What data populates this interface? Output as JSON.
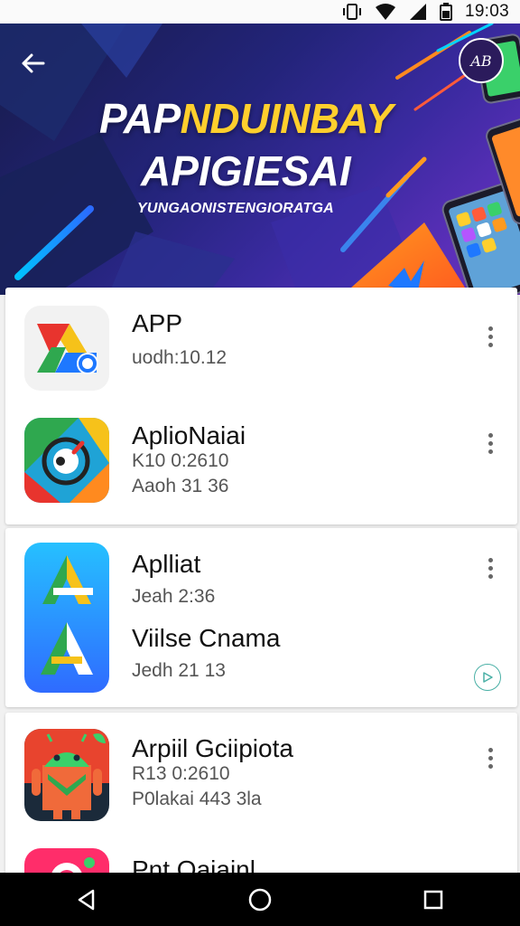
{
  "status_bar": {
    "time": "19:03",
    "icons": [
      "vibrate-icon",
      "wifi-icon",
      "signal-icon",
      "battery-icon"
    ]
  },
  "hero": {
    "title_line1_a": "PAP",
    "title_line1_b": "NDUINBAY",
    "title_line2": "APIGIESAI",
    "subtitle": "YUNGAONISTENGIORATGA",
    "badge_text": "AB",
    "back_icon": "arrow-back-icon"
  },
  "apps": [
    {
      "name": "APP",
      "meta": [
        "uodh:10.12"
      ],
      "icon": "google-drive-style-icon"
    },
    {
      "name": "AplioNaiai",
      "meta": [
        "K10 0:2610",
        "Aaoh 31 36"
      ],
      "icon": "colorful-compass-icon"
    },
    {
      "name": "Aplliat",
      "meta": [
        "Jeah 2:36"
      ],
      "icon": "blue-a-icon"
    },
    {
      "name": "Viilse Cnama",
      "meta": [
        "Jedh 21 13"
      ],
      "icon": "blue-a-icon"
    },
    {
      "name": "Arpiil Gciipiota",
      "meta": [
        "R13 0:2610",
        "P0lakai 443 3la"
      ],
      "icon": "android-robot-icon"
    },
    {
      "name": "Pnt Oaiainl",
      "meta": [],
      "icon": "pink-app-icon"
    }
  ],
  "colors": {
    "hero_bg": "#23247a",
    "accent_yellow": "#ffcf2d",
    "play_button": "#4ab0a6",
    "nav_bg": "#000000"
  },
  "nav": {
    "icons": [
      "back-triangle-icon",
      "home-circle-icon",
      "recents-square-icon"
    ]
  }
}
